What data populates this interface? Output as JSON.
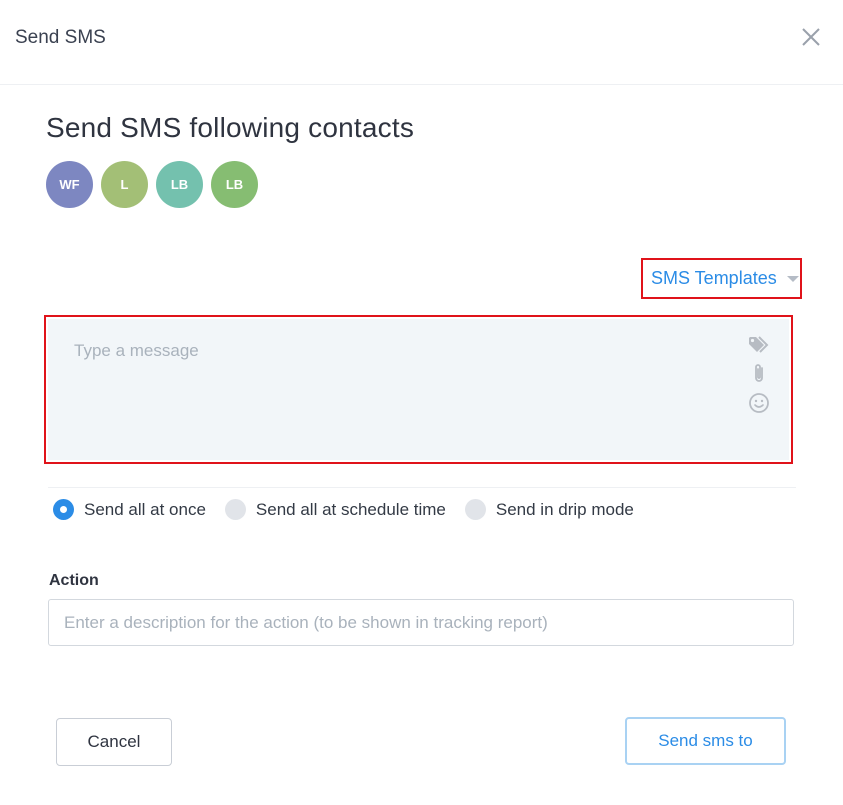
{
  "header": {
    "title": "Send SMS",
    "close_icon": "close-icon"
  },
  "main": {
    "title": "Send SMS following contacts",
    "contacts": [
      {
        "initials": "WF",
        "color": "#7d87c1"
      },
      {
        "initials": "L",
        "color": "#a3bf76"
      },
      {
        "initials": "LB",
        "color": "#74c1ae"
      },
      {
        "initials": "LB",
        "color": "#86bd72"
      }
    ],
    "templates": {
      "label": "SMS Templates",
      "icon": "chevron-down-icon"
    },
    "message": {
      "placeholder": "Type a message",
      "value": "",
      "icons": [
        "tag-icon",
        "paperclip-icon",
        "smiley-icon"
      ]
    },
    "send_mode": {
      "options": [
        {
          "label": "Send all at once",
          "checked": true
        },
        {
          "label": "Send all at schedule time",
          "checked": false
        },
        {
          "label": "Send in drip mode",
          "checked": false
        }
      ]
    },
    "action": {
      "label": "Action",
      "placeholder": "Enter a description for the action (to be shown in tracking report)",
      "value": ""
    }
  },
  "footer": {
    "cancel_label": "Cancel",
    "send_label": "Send sms to"
  },
  "colors": {
    "accent": "#2b8ce6",
    "highlight_border": "#e0131a",
    "message_bg": "#f2f6f9",
    "radio_unchecked": "#e1e4e9"
  }
}
